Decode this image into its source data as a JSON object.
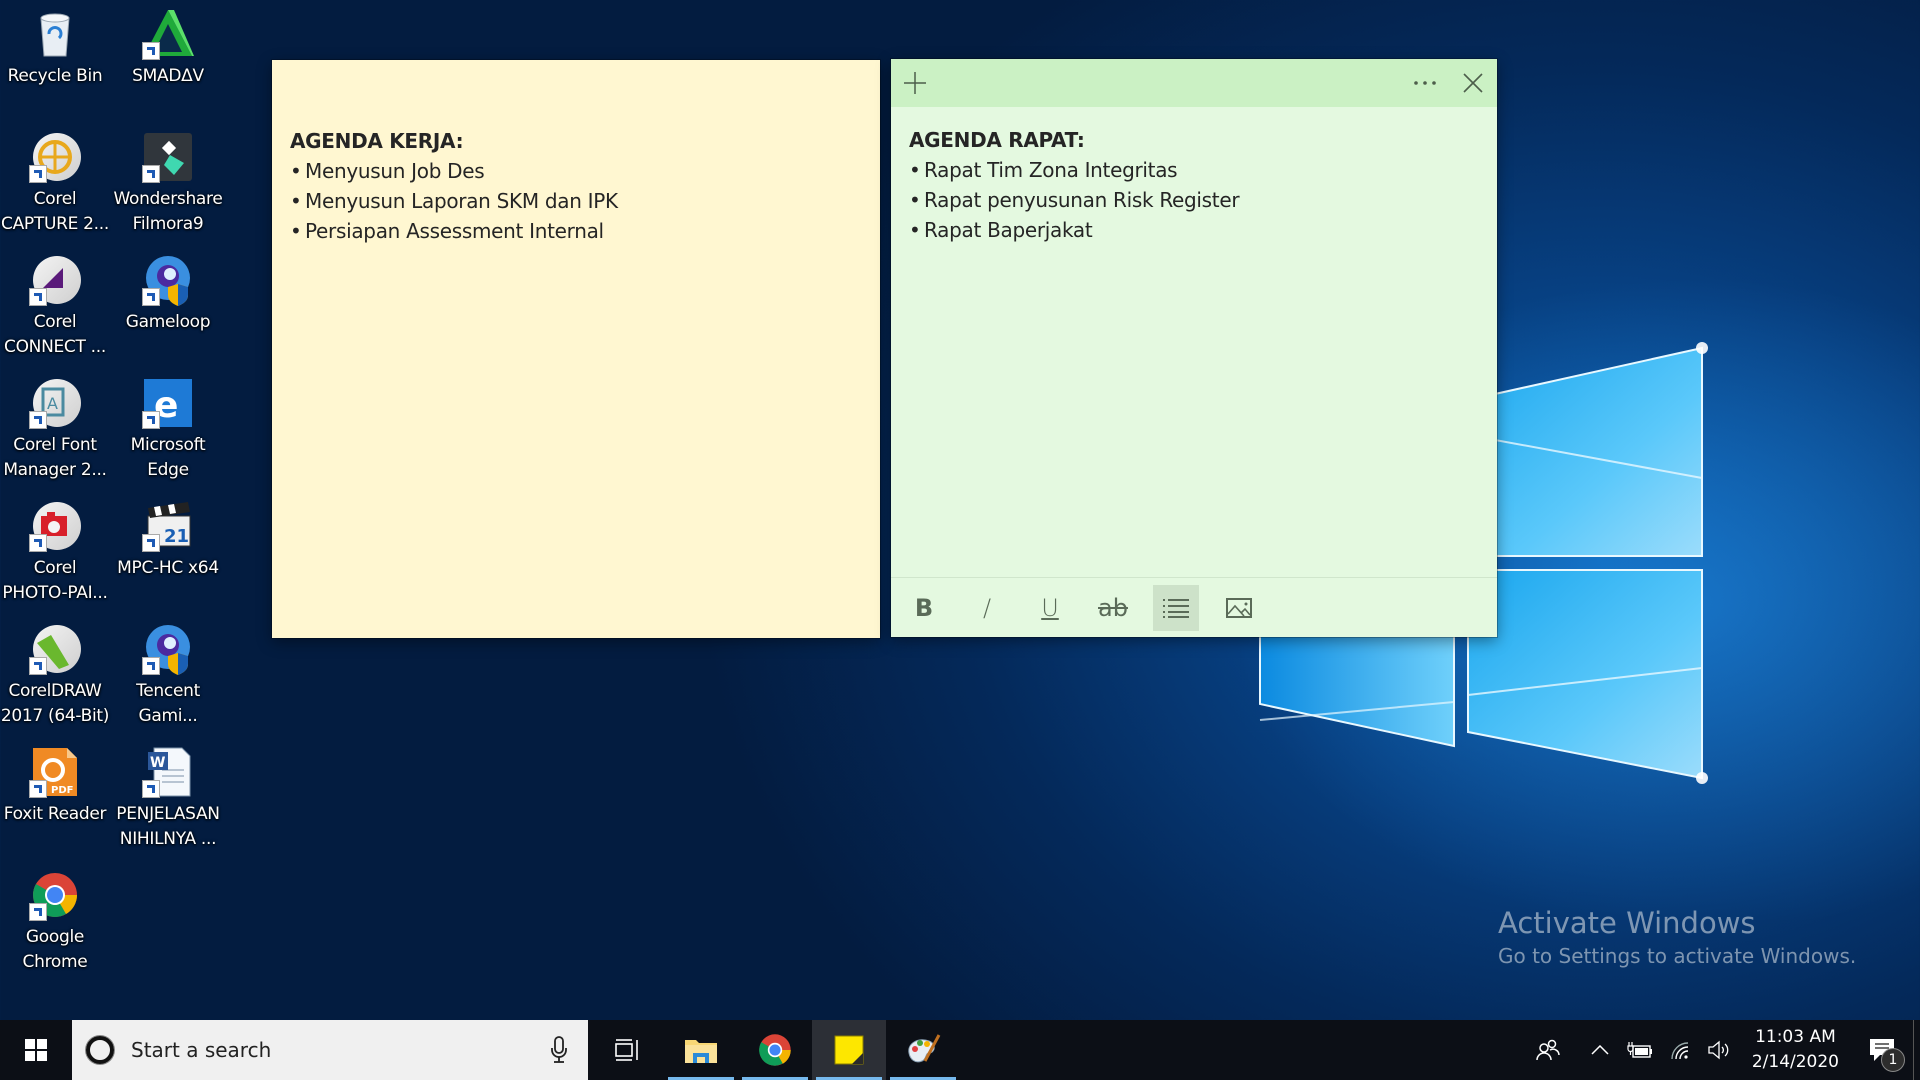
{
  "desktop": {
    "icons": [
      {
        "label": "Recycle Bin",
        "icon": "recycle-bin-icon"
      },
      {
        "label": "SMADΔV",
        "icon": "smadav-icon"
      },
      {
        "label": "Corel CAPTURE 2...",
        "icon": "corel-capture-icon"
      },
      {
        "label": "Wondershare Filmora9",
        "icon": "filmora-icon"
      },
      {
        "label": "Corel CONNECT ...",
        "icon": "corel-connect-icon"
      },
      {
        "label": "Gameloop",
        "icon": "gameloop-icon"
      },
      {
        "label": "Corel Font Manager 2...",
        "icon": "corel-font-manager-icon"
      },
      {
        "label": "Microsoft Edge",
        "icon": "edge-icon"
      },
      {
        "label": "Corel PHOTO-PAI...",
        "icon": "corel-photo-paint-icon"
      },
      {
        "label": "MPC-HC x64",
        "icon": "mpc-hc-icon"
      },
      {
        "label": "CorelDRAW 2017 (64-Bit)",
        "icon": "coreldraw-icon"
      },
      {
        "label": "Tencent Gami...",
        "icon": "tencent-gaming-icon"
      },
      {
        "label": "Foxit Reader",
        "icon": "foxit-reader-icon"
      },
      {
        "label": "PENJELASAN NIHILNYA ...",
        "icon": "word-document-icon"
      },
      {
        "label": "Google Chrome",
        "icon": "chrome-icon"
      }
    ]
  },
  "notes": {
    "yellow": {
      "color": "#fff7d1",
      "title": "AGENDA KERJA:",
      "items": [
        "Menyusun Job Des",
        "Menyusun Laporan SKM dan IPK",
        "Persiapan Assessment Internal"
      ]
    },
    "green": {
      "color": "#e4f9e0",
      "header_color": "#cbf1c4",
      "title": "AGENDA RAPAT:",
      "items": [
        "Rapat Tim Zona Integritas",
        "Rapat penyusunan Risk Register",
        "Rapat Baperjakat"
      ],
      "header": {
        "add_label": "+",
        "menu_label": "···",
        "close_label": "✕"
      },
      "toolbar": {
        "bold": "B",
        "italic": "/",
        "underline": "U",
        "strikethrough": "ab",
        "bullets_active": true
      }
    }
  },
  "watermark": {
    "title": "Activate Windows",
    "subtitle": "Go to Settings to activate Windows."
  },
  "taskbar": {
    "search_placeholder": "Start a search",
    "apps": [
      {
        "name": "task-view",
        "running": false
      },
      {
        "name": "file-explorer",
        "running": true
      },
      {
        "name": "google-chrome",
        "running": true
      },
      {
        "name": "sticky-notes",
        "running": true,
        "active": true
      },
      {
        "name": "paint",
        "running": true
      }
    ],
    "clock": {
      "time": "11:03 AM",
      "date": "2/14/2020"
    },
    "notifications_count": "1"
  }
}
